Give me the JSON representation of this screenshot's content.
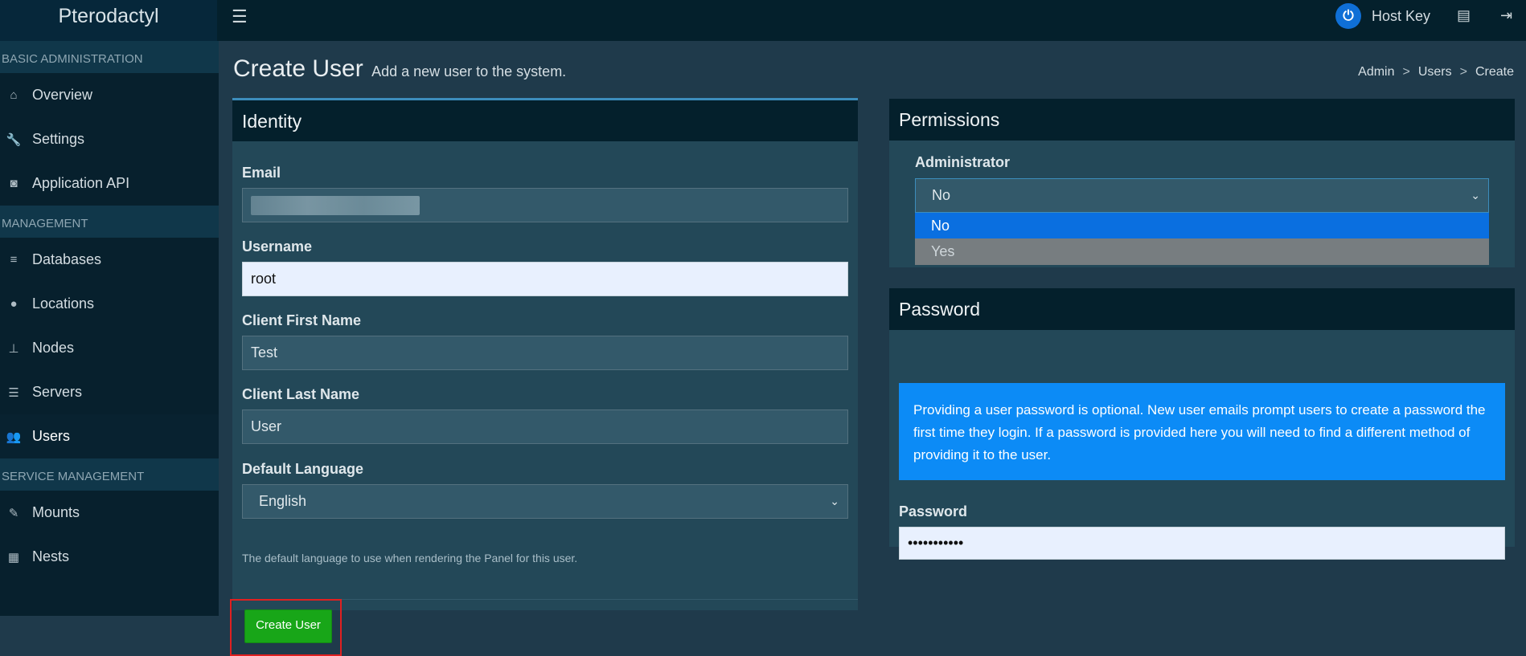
{
  "app": {
    "name": "Pterodactyl"
  },
  "topbar": {
    "username": "Host Key",
    "avatar_glyph": "⏻"
  },
  "sidebar": {
    "sections": [
      {
        "title": "BASIC ADMINISTRATION",
        "items": [
          {
            "label": "Overview",
            "icon": "home-icon"
          },
          {
            "label": "Settings",
            "icon": "wrench-icon"
          },
          {
            "label": "Application API",
            "icon": "gamepad-icon"
          }
        ]
      },
      {
        "title": "MANAGEMENT",
        "items": [
          {
            "label": "Databases",
            "icon": "database-icon"
          },
          {
            "label": "Locations",
            "icon": "globe-icon"
          },
          {
            "label": "Nodes",
            "icon": "sitemap-icon"
          },
          {
            "label": "Servers",
            "icon": "server-icon"
          },
          {
            "label": "Users",
            "icon": "users-icon",
            "active": true
          }
        ]
      },
      {
        "title": "SERVICE MANAGEMENT",
        "items": [
          {
            "label": "Mounts",
            "icon": "magic-icon"
          },
          {
            "label": "Nests",
            "icon": "grid-icon"
          }
        ]
      }
    ]
  },
  "page": {
    "title": "Create User",
    "subtitle": "Add a new user to the system.",
    "breadcrumb": [
      "Admin",
      "Users",
      "Create"
    ]
  },
  "identity": {
    "title": "Identity",
    "email_label": "Email",
    "username_label": "Username",
    "username_value": "root",
    "first_name_label": "Client First Name",
    "first_name_value": "Test",
    "last_name_label": "Client Last Name",
    "last_name_value": "User",
    "language_label": "Default Language",
    "language_value": "English",
    "language_help": "The default language to use when rendering the Panel for this user.",
    "submit_label": "Create User"
  },
  "permissions": {
    "title": "Permissions",
    "admin_label": "Administrator",
    "admin_value": "No",
    "admin_options": [
      "No",
      "Yes"
    ]
  },
  "password": {
    "title": "Password",
    "info": "Providing a user password is optional. New user emails prompt users to create a password the first time they login. If a password is provided here you will need to find a different method of providing it to the user.",
    "label": "Password",
    "value": "•••••••••••"
  }
}
